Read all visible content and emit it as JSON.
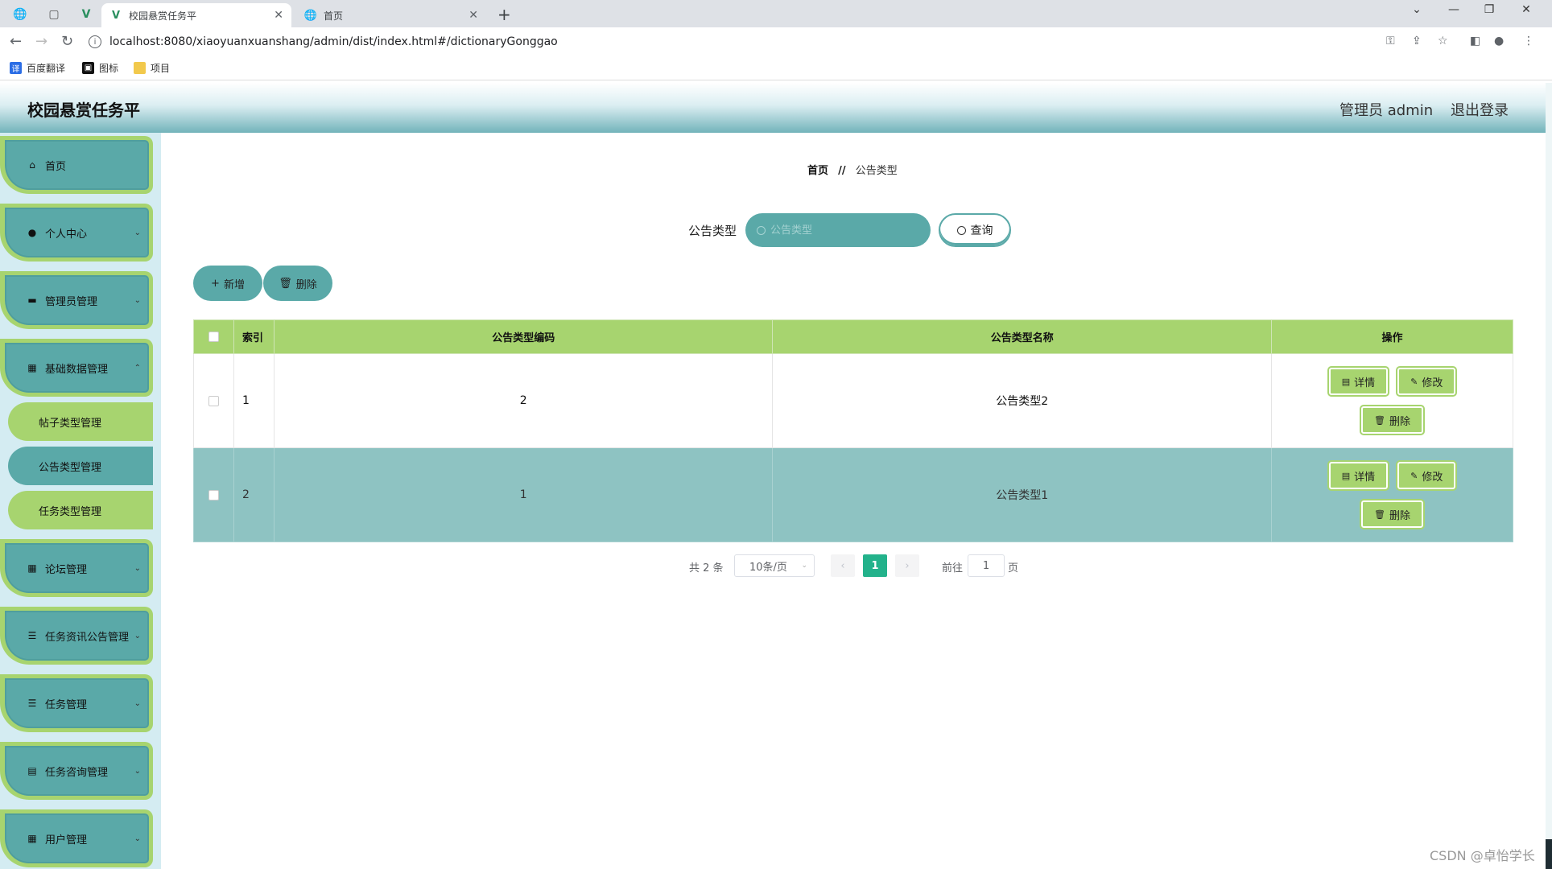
{
  "browser": {
    "tabs": [
      {
        "title": "校园悬赏任务平",
        "active": true
      },
      {
        "title": "首页",
        "active": false
      }
    ],
    "url": "localhost:8080/xiaoyuanxuanshang/admin/dist/index.html#/dictionaryGonggao",
    "bookmarks": [
      "百度翻译",
      "图标",
      "项目"
    ]
  },
  "header": {
    "title": "校园悬赏任务平",
    "user_label": "管理员 admin",
    "logout_label": "退出登录"
  },
  "sidebar": {
    "items": [
      {
        "label": "首页",
        "icon": "home-icon"
      },
      {
        "label": "个人中心",
        "icon": "user-icon"
      },
      {
        "label": "管理员管理",
        "icon": "chat-icon"
      },
      {
        "label": "基础数据管理",
        "icon": "grid-icon"
      },
      {
        "label": "论坛管理",
        "icon": "grid-icon"
      },
      {
        "label": "任务资讯公告管理",
        "icon": "list-icon"
      },
      {
        "label": "任务管理",
        "icon": "list-icon"
      },
      {
        "label": "任务咨询管理",
        "icon": "clipboard-icon"
      },
      {
        "label": "用户管理",
        "icon": "grid-icon"
      }
    ],
    "subitems": [
      {
        "label": "帖子类型管理"
      },
      {
        "label": "公告类型管理"
      },
      {
        "label": "任务类型管理"
      }
    ]
  },
  "breadcrumb": {
    "home": "首页",
    "separator": "//",
    "current": "公告类型"
  },
  "search": {
    "label": "公告类型",
    "placeholder": "公告类型",
    "query_label": "查询"
  },
  "actions": {
    "add_label": "新增",
    "delete_label": "删除"
  },
  "table": {
    "headers": {
      "index": "索引",
      "code": "公告类型编码",
      "name": "公告类型名称",
      "ops": "操作"
    },
    "rows": [
      {
        "index": "1",
        "code": "2",
        "name": "公告类型2"
      },
      {
        "index": "2",
        "code": "1",
        "name": "公告类型1"
      }
    ],
    "op_labels": {
      "detail": "详情",
      "edit": "修改",
      "delete": "删除"
    }
  },
  "pagination": {
    "total": "共 2 条",
    "page_size": "10条/页",
    "current_page": "1",
    "goto_label": "前往",
    "goto_value": "1",
    "page_unit": "页"
  },
  "watermark": "CSDN @卓怡学长",
  "colors": {
    "teal": "#5aa9a8",
    "green": "#a7d46f",
    "row_alt": "#8ec3c2",
    "page_active": "#23b28b"
  }
}
